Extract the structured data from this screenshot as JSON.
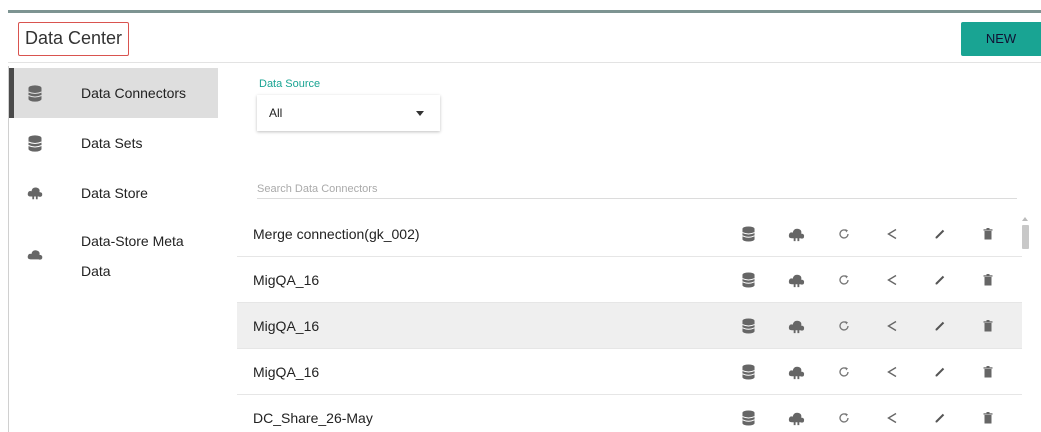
{
  "header": {
    "title": "Data Center",
    "new_label": "NEW"
  },
  "sidebar": {
    "items": [
      {
        "label": "Data Connectors",
        "icon": "database-icon",
        "active": true
      },
      {
        "label": "Data Sets",
        "icon": "database-icon",
        "active": false
      },
      {
        "label": "Data Store",
        "icon": "cloud-store-icon",
        "active": false
      },
      {
        "label": "Data-Store Meta Data",
        "icon": "cloud-icon",
        "active": false
      }
    ]
  },
  "filter": {
    "label": "Data Source",
    "value": "All"
  },
  "search": {
    "placeholder": "Search Data Connectors"
  },
  "rows": [
    {
      "name": "Merge connection(gk_002)"
    },
    {
      "name": "MigQA_16"
    },
    {
      "name": "MigQA_16"
    },
    {
      "name": "MigQA_16"
    },
    {
      "name": "DC_Share_26-May"
    }
  ],
  "row_actions": [
    "database-icon",
    "cloud-store-icon",
    "refresh-icon",
    "share-icon",
    "edit-icon",
    "delete-icon"
  ],
  "colors": {
    "accent": "#19a493",
    "title_border": "#d9534f",
    "active_bg": "#dedede",
    "hover_row": "#efefef"
  }
}
